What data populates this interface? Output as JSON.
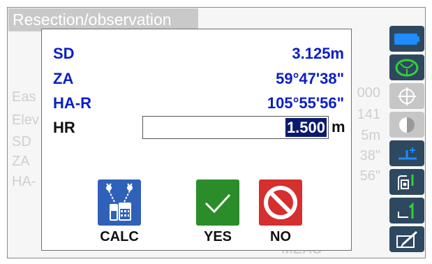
{
  "screen": {
    "title": "Resection/observation",
    "background_rows": [
      {
        "label": "Eas",
        "value": "000"
      },
      {
        "label": "Elev",
        "value": "141"
      },
      {
        "label": "SD",
        "value": "5m"
      },
      {
        "label": "ZA",
        "value": "38\""
      },
      {
        "label": "HA-",
        "value": "56\""
      }
    ],
    "meas_label": "MEAS"
  },
  "dialog": {
    "rows": [
      {
        "label": "SD",
        "value": "3.125m"
      },
      {
        "label": "ZA",
        "value": "59°47'38\""
      },
      {
        "label": "HA-R",
        "value": "105°55'56\""
      }
    ],
    "hr": {
      "label": "HR",
      "value": "1.500",
      "unit": "m"
    },
    "buttons": {
      "calc": "CALC",
      "yes": "YES",
      "no": "NO"
    }
  },
  "sidebar": {
    "icons": [
      "battery-icon",
      "tilt-icon",
      "target-icon",
      "laser-icon",
      "height-icon",
      "prism-icon",
      "page-one-icon",
      "edit-icon"
    ],
    "colors": {
      "accent": "#1e8bff",
      "green": "#35d035",
      "dark": "#2e4860"
    }
  }
}
